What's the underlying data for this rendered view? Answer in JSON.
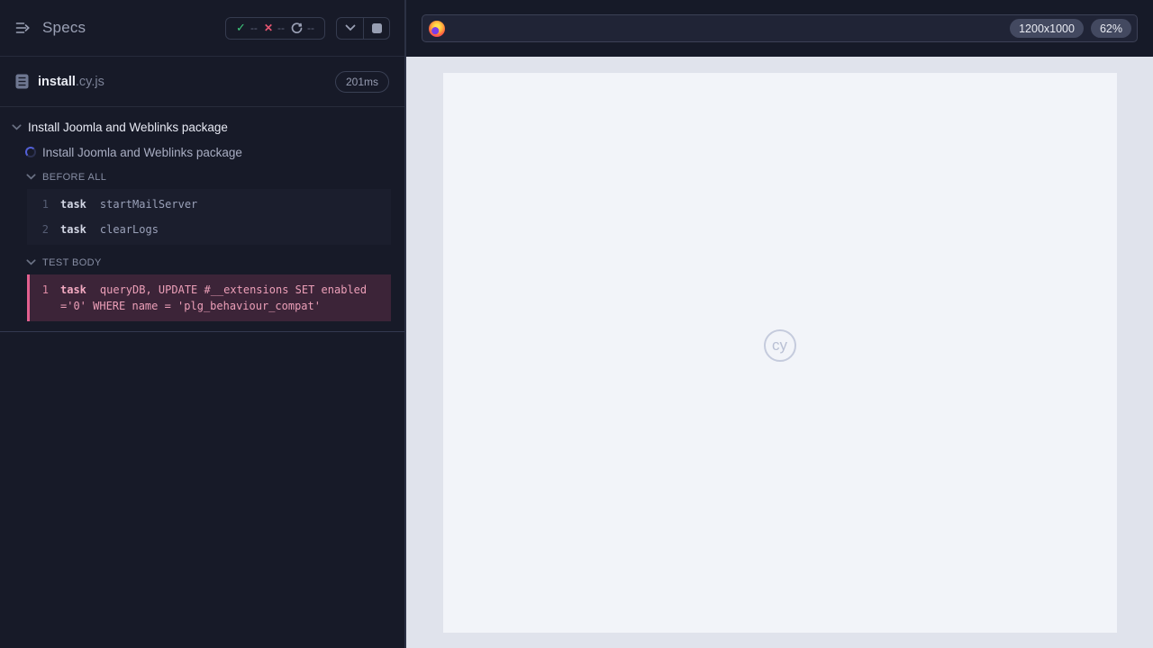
{
  "sidebar": {
    "title": "Specs",
    "stats": {
      "passed": "--",
      "failed": "--",
      "pending": "--"
    },
    "spec": {
      "name": "install",
      "ext": ".cy.js",
      "duration": "201ms"
    },
    "tree": {
      "suite_title": "Install Joomla and Weblinks package",
      "test_title": "Install Joomla and Weblinks package",
      "sections": [
        {
          "label": "BEFORE ALL",
          "commands": [
            {
              "num": "1",
              "method": "task",
              "message": "startMailServer"
            },
            {
              "num": "2",
              "method": "task",
              "message": "clearLogs"
            }
          ]
        },
        {
          "label": "TEST BODY",
          "commands": [
            {
              "num": "1",
              "method": "task",
              "message": "queryDB, UPDATE #__extensions SET enabled ='0' WHERE name = 'plg_behaviour_compat'"
            }
          ]
        }
      ]
    }
  },
  "browser": {
    "viewport_size": "1200x1000",
    "zoom_level": "62%"
  },
  "aut": {
    "watermark": "cy"
  },
  "colors": {
    "accent_highlight": "#e2608f",
    "pass_green": "#3dc97c",
    "fail_red": "#e45570",
    "running_spinner": "#5360d8",
    "sidebar_bg": "#171a28",
    "stage_bg": "#e0e3ec",
    "viewport_bg": "#f2f4f9"
  }
}
